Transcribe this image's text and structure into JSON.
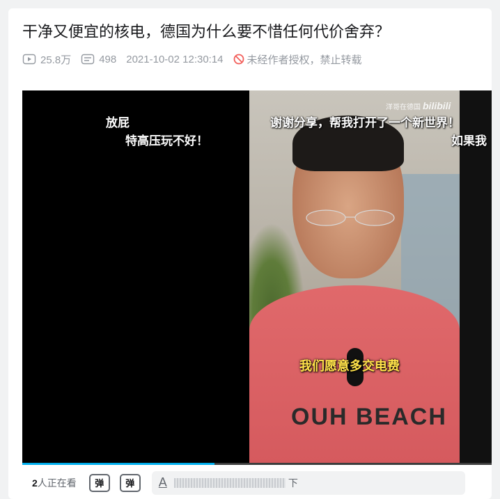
{
  "video": {
    "title": "干净又便宜的核电，德国为什么要不惜任何代价舍弃？",
    "plays": "25.8万",
    "danmaku_count": "498",
    "publish_time": "2021-10-02 12:30:14",
    "copyright_notice": "未经作者授权，禁止转载"
  },
  "player": {
    "watermark_text": "洋哥在德国",
    "watermark_brand": "bilibili",
    "danmaku": [
      "放屁",
      "特高压玩不好！",
      "谢谢分享，帮我打开了一个新世界！",
      "如果我"
    ],
    "caption": "我们愿意多交电费",
    "shirt_text": "OUH BEACH",
    "progress": 0.41
  },
  "bottom_bar": {
    "viewers_count": "2",
    "viewers_suffix": "人正在看",
    "danmaku_on_icon": "弹",
    "danmaku_settings_icon": "弹",
    "input_font_icon": "A",
    "input_tail": "下"
  },
  "colors": {
    "accent": "#00aeec",
    "caption": "#ffe24a",
    "warn": "#f25d59"
  }
}
